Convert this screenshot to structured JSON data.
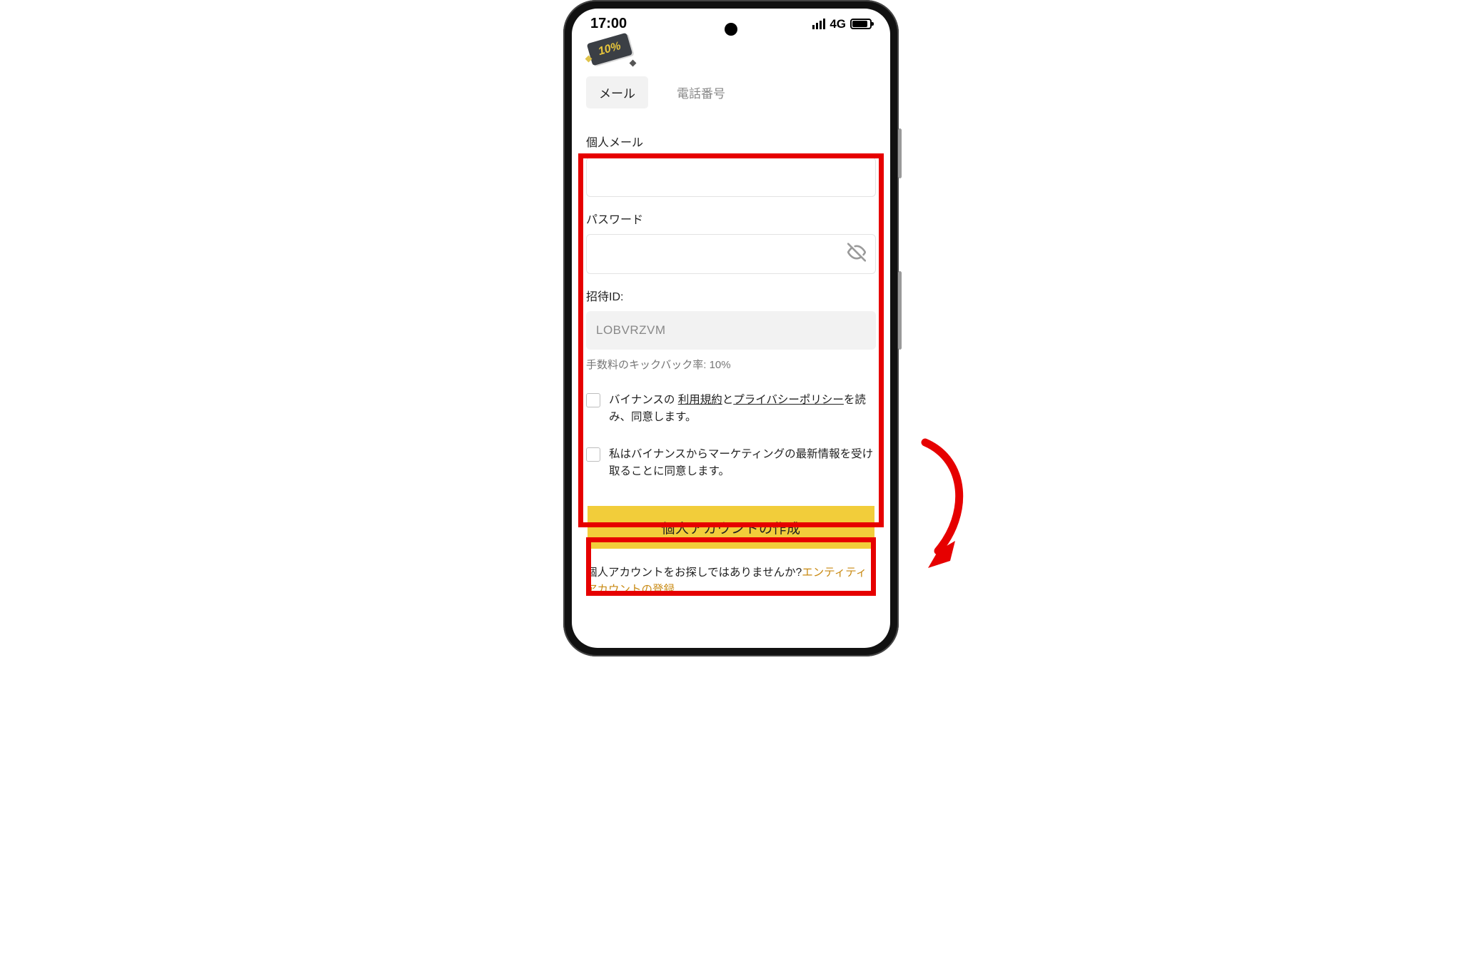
{
  "status_bar": {
    "time": "17:00",
    "network_label": "4G"
  },
  "coupon": {
    "discount_text": "10%"
  },
  "tabs": {
    "email": "メール",
    "phone": "電話番号"
  },
  "form": {
    "email_label": "個人メール",
    "password_label": "パスワード",
    "referral_label": "招待ID:",
    "referral_value": "LOBVRZVM",
    "kickback_text": "手数料のキックバック率: 10%",
    "terms_pre": "バイナンスの ",
    "terms_link1": "利用規約",
    "terms_mid": "と",
    "terms_link2": "プライバシーポリシー",
    "terms_post": "を読み、同意します。",
    "marketing_text": "私はバイナンスからマーケティングの最新情報を受け取ることに同意します。"
  },
  "cta": {
    "create_label": "個人アカウントの作成"
  },
  "footer": {
    "q_text": "個人アカウントをお探しではありませんか?",
    "link_text": "エンティティアカウントの登録"
  },
  "colors": {
    "highlight": "#e60000",
    "primary": "#f2cd3a",
    "link_orange": "#c98a13"
  }
}
